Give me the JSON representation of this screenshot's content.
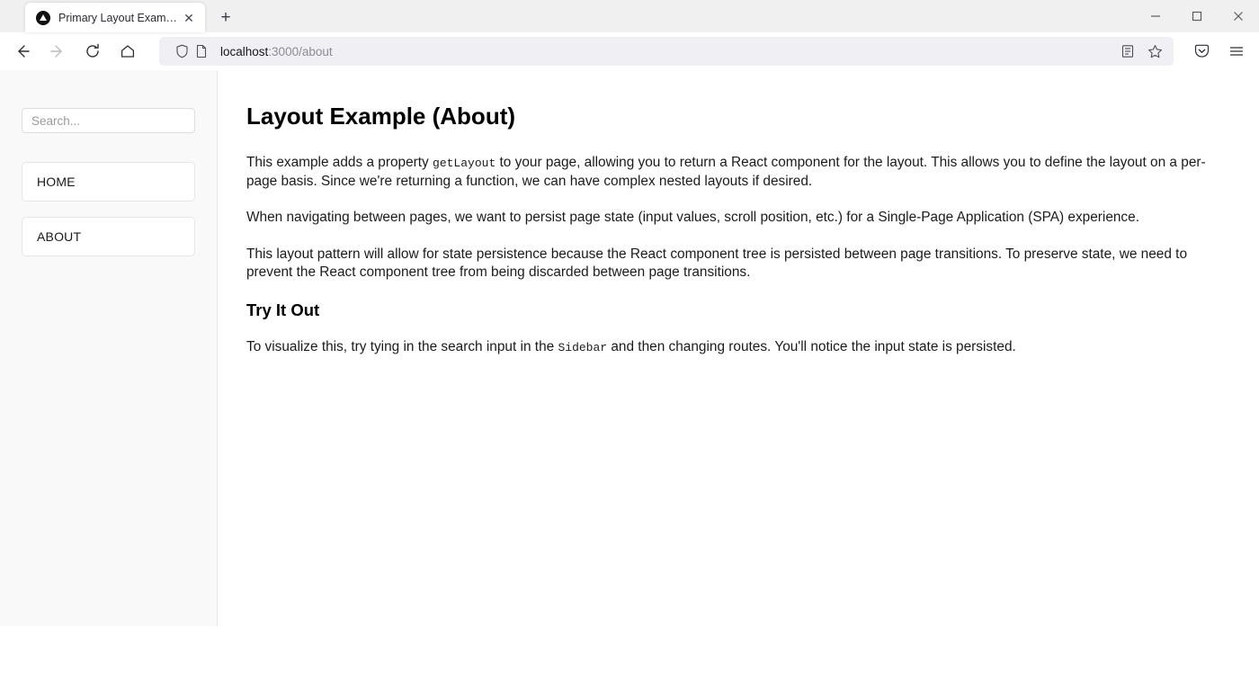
{
  "browser": {
    "tab": {
      "title": "Primary Layout Example",
      "favicon_name": "nextjs-triangle-icon",
      "close_label": "✕"
    },
    "new_tab_label": "+",
    "window_controls": {
      "minimize": "—",
      "maximize": "▢",
      "close": "✕"
    },
    "toolbar": {
      "back_label": "←",
      "forward_label": "→",
      "reload_label": "⟳",
      "home_label": "⌂"
    },
    "url": {
      "host": "localhost",
      "path": ":3000/about",
      "shield_icon": "shield-icon",
      "page_icon": "page-icon"
    },
    "url_actions": {
      "reader_view": "reader-view-icon",
      "bookmark": "star-icon"
    },
    "right_actions": {
      "pocket": "pocket-icon",
      "menu": "hamburger-menu-icon"
    }
  },
  "sidebar": {
    "search": {
      "placeholder": "Search...",
      "value": ""
    },
    "items": [
      {
        "label": "HOME"
      },
      {
        "label": "ABOUT"
      }
    ]
  },
  "main": {
    "title": "Layout Example (About)",
    "paragraph1": {
      "part1": "This example adds a property ",
      "code1": "getLayout",
      "part2": " to your page, allowing you to return a React component for the layout. This allows you to define the layout on a per-page basis. Since we're returning a function, we can have complex nested layouts if desired."
    },
    "paragraph2": "When navigating between pages, we want to persist page state (input values, scroll position, etc.) for a Single-Page Application (SPA) experience.",
    "paragraph3": "This layout pattern will allow for state persistence because the React component tree is persisted between page transitions. To preserve state, we need to prevent the React component tree from being discarded between page transitions.",
    "section_title": "Try It Out",
    "paragraph4": {
      "part1": "To visualize this, try tying in the search input in the ",
      "code1": "Sidebar",
      "part2": " and then changing routes. You'll notice the input state is persisted."
    }
  },
  "colors": {
    "tabstrip_bg": "#f0f0f1",
    "sidebar_bg": "#f9f9f9",
    "sidebar_border": "#e7e7e8",
    "urlbar_bg": "#f0f0f4",
    "text": "#1b1b1b"
  }
}
